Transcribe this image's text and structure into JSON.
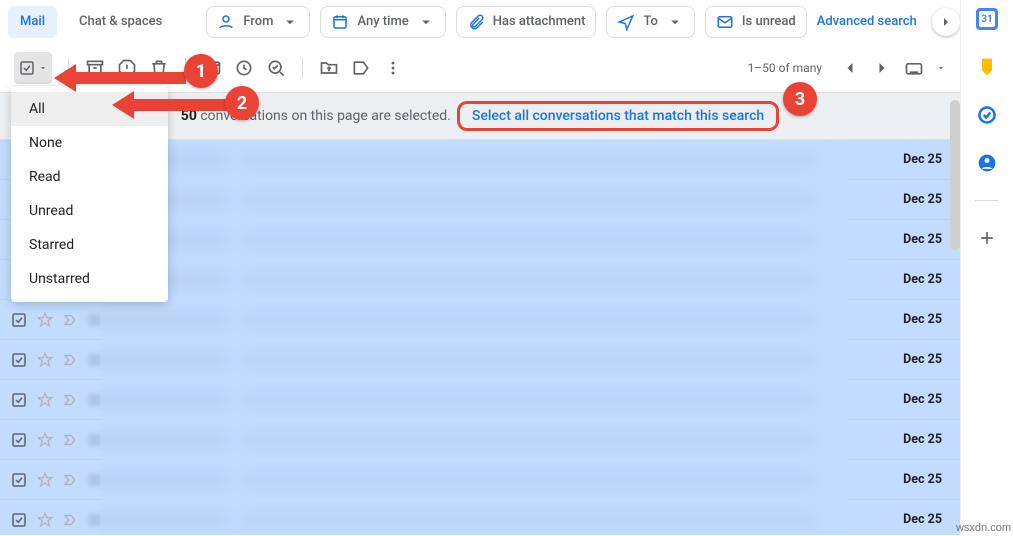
{
  "tabs": {
    "mail": "Mail",
    "chat": "Chat & spaces"
  },
  "filters": {
    "from": "From",
    "anytime": "Any time",
    "attach": "Has attachment",
    "to": "To",
    "unread": "Is unread",
    "adv": "Advanced search"
  },
  "toolbar": {
    "range": "1–50 of many"
  },
  "dropdown": {
    "items": [
      "All",
      "None",
      "Read",
      "Unread",
      "Starred",
      "Unstarred"
    ]
  },
  "banner": {
    "count": "50",
    "text": " conversations on this page are selected. ",
    "link": "Select all conversations that match this search"
  },
  "rows": [
    "Dec 25",
    "Dec 25",
    "Dec 25",
    "Dec 25",
    "Dec 25",
    "Dec 25",
    "Dec 25",
    "Dec 25",
    "Dec 25",
    "Dec 25"
  ],
  "annotations": {
    "b1": "1",
    "b2": "2",
    "b3": "3"
  },
  "side_icons": [
    "calendar",
    "keep",
    "tasks",
    "contacts",
    "plus"
  ],
  "watermark": "wsxdn.com"
}
